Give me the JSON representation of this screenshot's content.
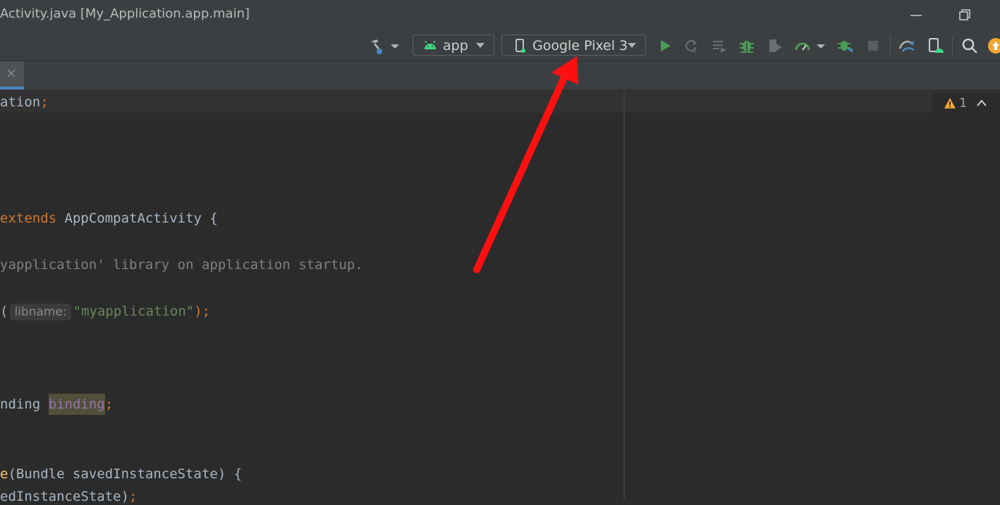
{
  "window": {
    "title": "Activity.java [My_Application.app.main]"
  },
  "toolbar": {
    "module_combo": "app",
    "device_combo": "Google Pixel 3",
    "icons": [
      "hammer-build-icon",
      "android-icon",
      "device-icon",
      "run-icon",
      "apply-changes-icon",
      "apply-code-changes-icon",
      "debug-icon",
      "coverage-icon",
      "profile-icon",
      "attach-debugger-icon",
      "stop-icon",
      "sync-gradle-icon",
      "device-manager-icon",
      "search-icon",
      "update-icon"
    ]
  },
  "editor": {
    "lines": {
      "l1_a": "ation",
      "l1_b": ";",
      "l2_kw": "extends",
      "l2_rest": " AppCompatActivity {",
      "l3": "yapplication' library on application startup.",
      "l4_a": "(",
      "l4_hint": "libname:",
      "l4_str": "\"myapplication\"",
      "l4_end": ");",
      "l5_a": "nding ",
      "l5_hl": "binding",
      "l5_b": ";",
      "l6_fn": "e",
      "l6_rest": "(Bundle savedInstanceState) {",
      "l7_a": "edInstanceState)",
      "l7_b": ";"
    },
    "warnings_count": "1"
  },
  "colors": {
    "annotation_arrow": "#ff1010",
    "accent": "#4a88c7"
  }
}
